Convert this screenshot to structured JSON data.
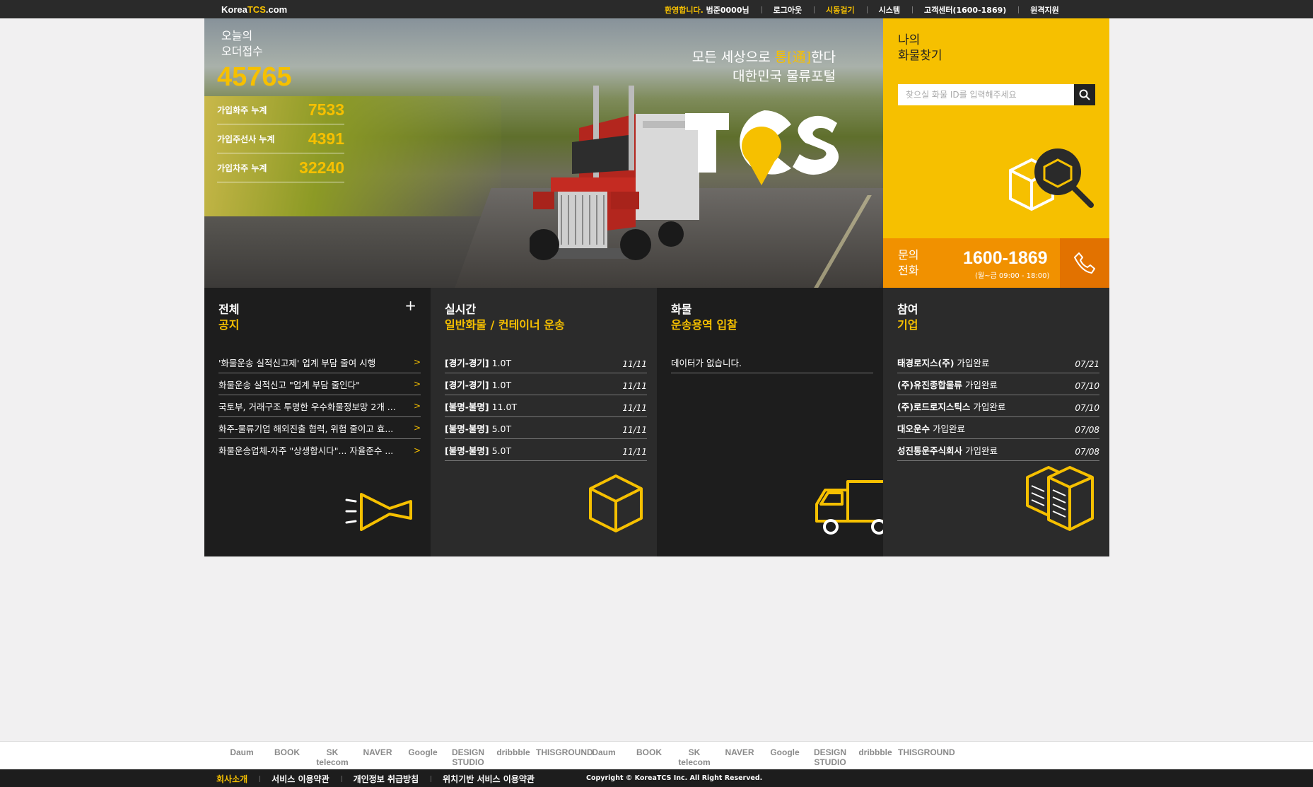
{
  "topbar": {
    "logo_prefix": "Korea",
    "logo_accent": "TCS",
    "logo_suffix": ".com",
    "welcome_highlight": "환영합니다.",
    "welcome_user": "범준0000님",
    "nav": [
      "로그아웃",
      "시동걸기",
      "시스템",
      "고객센터(1600-1869)",
      "원격지원"
    ]
  },
  "hero": {
    "order_title_1": "오늘의",
    "order_title_2": "오더접수",
    "order_count": "45765",
    "stats": [
      {
        "label": "가입화주 누계",
        "value": "7533"
      },
      {
        "label": "가입주선사 누계",
        "value": "4391"
      },
      {
        "label": "가입차주 누계",
        "value": "32240"
      }
    ],
    "slogan_pre": "모든 세상으로 ",
    "slogan_accent": "통[通]",
    "slogan_post": "한다",
    "slogan_line2": "대한민국 물류포털",
    "brand_logo": "TCS"
  },
  "side": {
    "title_1": "나의",
    "title_2": "화물찾기",
    "search_placeholder": "찾으실 화물 ID를 입력해주세요",
    "phone_label_1": "문의",
    "phone_label_2": "전화",
    "phone_number": "1600-1869",
    "phone_hours": "(월~금 09:00 - 18:00)"
  },
  "panels": {
    "notice": {
      "h1": "전체",
      "h2": "공지",
      "plus": "+",
      "items": [
        "'화물운송 실적신고제' 업계 부담 줄여 시행",
        "화물운송 실적신고 \"업계 부담 줄인다\"",
        "국토부, 거래구조 투명한 우수화물정보망 2개 ...",
        "화주-물류기업 해외진출 협력, 위험 줄이고 효...",
        "화물운송업체-자주 \"상생합시다\"... 자율준수 ..."
      ]
    },
    "realtime": {
      "h1": "실시간",
      "h2": "일반화물 / 컨테이너 운송",
      "items": [
        {
          "route": "[경기-경기]",
          "ton": "1.0T",
          "date": "11/11"
        },
        {
          "route": "[경기-경기]",
          "ton": "1.0T",
          "date": "11/11"
        },
        {
          "route": "[불명-불명]",
          "ton": "11.0T",
          "date": "11/11"
        },
        {
          "route": "[불명-불명]",
          "ton": "5.0T",
          "date": "11/11"
        },
        {
          "route": "[불명-불명]",
          "ton": "5.0T",
          "date": "11/11"
        }
      ]
    },
    "bid": {
      "h1": "화물",
      "h2": "운송용역 입찰",
      "items": [
        "데이터가 없습니다."
      ]
    },
    "join": {
      "h1": "참여",
      "h2": "기업",
      "items": [
        {
          "name": "태경로지스(주)",
          "status": "가입완료",
          "date": "07/21"
        },
        {
          "name": "(주)유진종합물류",
          "status": "가입완료",
          "date": "07/10"
        },
        {
          "name": "(주)로드로지스틱스",
          "status": "가입완료",
          "date": "07/10"
        },
        {
          "name": "대오운수",
          "status": "가입완료",
          "date": "07/08"
        },
        {
          "name": "성진통운주식회사",
          "status": "가입완료",
          "date": "07/08"
        }
      ]
    }
  },
  "brands": [
    "Daum",
    "BOOK",
    "SK telecom",
    "NAVER",
    "Google",
    "DESIGN STUDIO",
    "dribbble",
    "THISGROUND",
    "Daum",
    "BOOK",
    "SK telecom",
    "NAVER",
    "Google",
    "DESIGN STUDIO",
    "dribbble",
    "THISGROUND"
  ],
  "footer": {
    "links": [
      "회사소개",
      "서비스 이용약관",
      "개인정보 취급방침",
      "위치기반 서비스 이용약관"
    ],
    "copyright": "Copyright © KoreaTCS Inc. All Right Reserved."
  },
  "colors": {
    "accent": "#f6c000",
    "orange": "#f19100",
    "dark": "#1d1d1d"
  }
}
